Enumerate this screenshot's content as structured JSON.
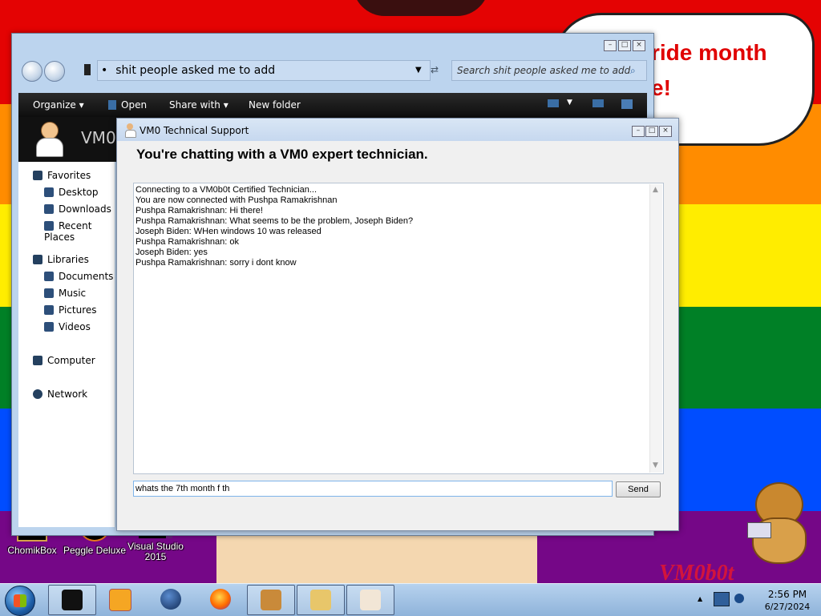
{
  "wallpaper": {
    "stripes": [
      "#e40303",
      "#ff8c00",
      "#ffed00",
      "#008026",
      "#004dff",
      "#750787"
    ],
    "bubble_text": [
      "ride month",
      "e!"
    ]
  },
  "desktop_icons": [
    {
      "label": "ChomikBox"
    },
    {
      "label": "Peggle Deluxe"
    },
    {
      "label": "Visual Studio 2015"
    }
  ],
  "explorer": {
    "address": "shit people asked me to add",
    "search_placeholder": "Search shit people asked me to add",
    "toolbar": {
      "organize": "Organize",
      "open": "Open",
      "share_with": "Share with",
      "new_folder": "New folder"
    },
    "header_text": "VM0",
    "nav": {
      "favorites": "Favorites",
      "desktop": "Desktop",
      "downloads": "Downloads",
      "recent_places": "Recent Places",
      "libraries": "Libraries",
      "documents": "Documents",
      "music": "Music",
      "pictures": "Pictures",
      "videos": "Videos",
      "computer": "Computer",
      "network": "Network"
    }
  },
  "chat": {
    "title": "VM0 Technical Support",
    "heading": "You're chatting with a VM0 expert technician.",
    "lines": [
      "Connecting to a VM0b0t Certified Technician...",
      "You are now connected with Pushpa Ramakrishnan",
      "Pushpa Ramakrishnan: Hi there!",
      "Pushpa Ramakrishnan: What seems to be the problem, Joseph Biden?",
      "Joseph Biden: WHen windows 10 was released",
      "Pushpa Ramakrishnan: ok",
      "Joseph Biden: yes",
      "Pushpa Ramakrishnan: sorry i dont know"
    ],
    "input_value": "whats the 7th month f th",
    "send_label": "Send"
  },
  "taskbar": {
    "clock_time": "2:56 PM",
    "clock_date": "6/27/2024"
  },
  "watermark": "VM0b0t"
}
